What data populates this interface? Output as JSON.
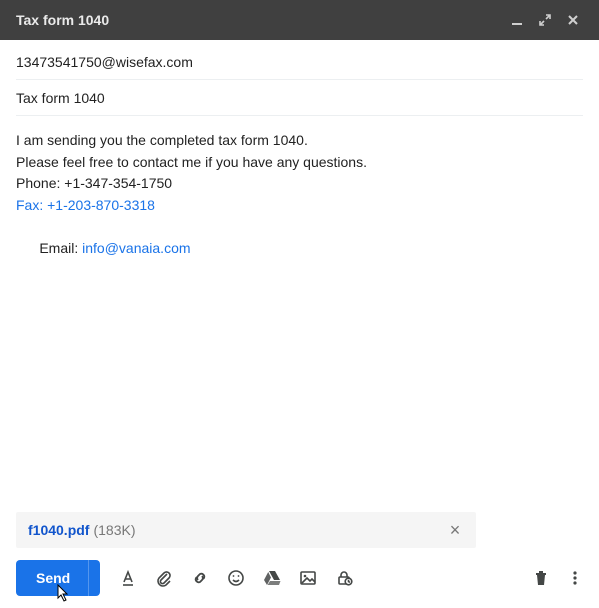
{
  "header": {
    "title": "Tax form 1040"
  },
  "to": "13473541750@wisefax.com",
  "subject": "Tax form 1040",
  "body": {
    "line1": "I am sending you the completed tax form 1040.",
    "line2": "Please feel free to contact me if you have any questions.",
    "line3": "Phone: +1-347-354-1750",
    "fax": "Fax: +1-203-870-3318",
    "email_label": "Email: ",
    "email_link": "info@vanaia.com"
  },
  "attachment": {
    "name": "f1040.pdf",
    "size": "(183K)"
  },
  "toolbar": {
    "send_label": "Send"
  }
}
